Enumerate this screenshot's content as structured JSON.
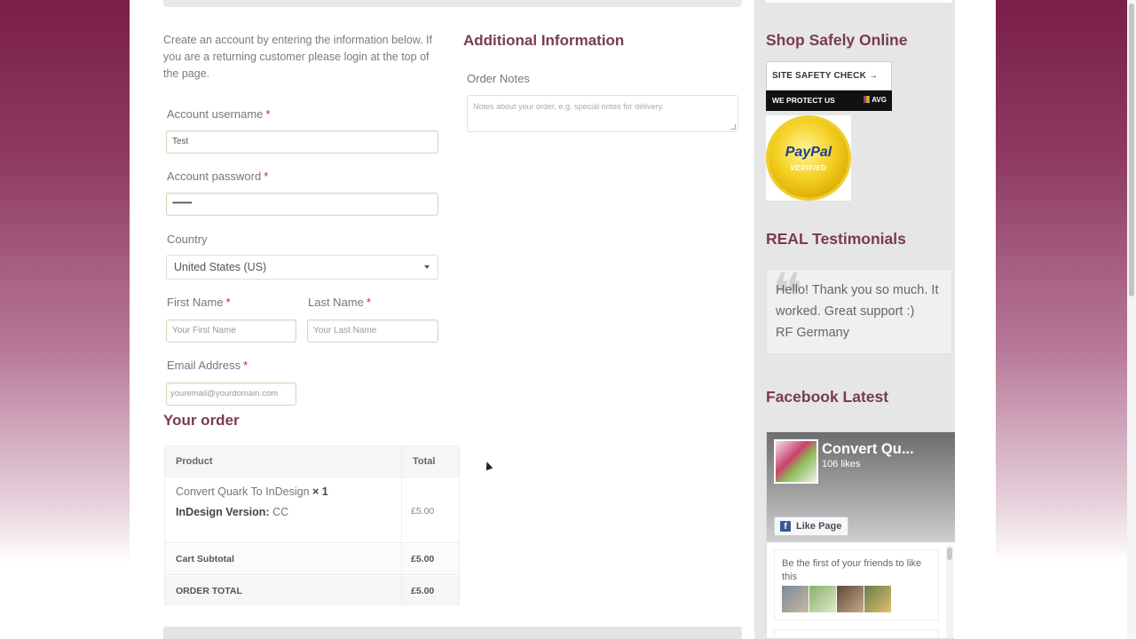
{
  "intro": "Create an account by entering the information below. If you are a returning customer please login at the top of the page.",
  "form": {
    "username_label": "Account username",
    "username_value": "Test",
    "password_label": "Account password",
    "password_value": "••••••••••••",
    "country_label": "Country",
    "country_value": "United States (US)",
    "first_name_label": "First Name",
    "first_name_placeholder": "Your First Name",
    "last_name_label": "Last Name",
    "last_name_placeholder": "Your Last Name",
    "email_label": "Email Address",
    "email_placeholder": "youremail@yourdomain.com",
    "required_mark": "*"
  },
  "additional": {
    "heading": "Additional Information",
    "notes_label": "Order Notes",
    "notes_placeholder": "Notes about your order, e.g. special notes for delivery."
  },
  "order": {
    "heading": "Your order",
    "col_product": "Product",
    "col_total": "Total",
    "item_name": "Convert Quark To InDesign",
    "item_qty": "× 1",
    "item_meta_label": "InDesign Version:",
    "item_meta_value": "CC",
    "item_price": "£5.00",
    "subtotal_label": "Cart Subtotal",
    "subtotal_value": "£5.00",
    "total_label": "ORDER TOTAL",
    "total_value": "£5.00"
  },
  "sidebar": {
    "shop_safely_heading": "Shop Safely Online",
    "safety_check": "SITE SAFETY CHECK →",
    "we_protect": "WE PROTECT US",
    "avg": "AVG",
    "paypal": "PayPal",
    "paypal_verified": "VERIFIED",
    "testimonials_heading": "REAL Testimonials",
    "testimonial_text": "Hello! Thank you so much. It worked. Great support :)",
    "testimonial_author": "RF  Germany",
    "facebook_heading": "Facebook Latest",
    "fb_page_name": "Convert Qu...",
    "fb_likes": "106 likes",
    "fb_like_button": "Like Page",
    "fb_friends_text": "Be the first of your friends to like this"
  },
  "colors": {
    "heading": "#7a3a56",
    "required": "#c0272d",
    "facebook": "#3b5998"
  }
}
